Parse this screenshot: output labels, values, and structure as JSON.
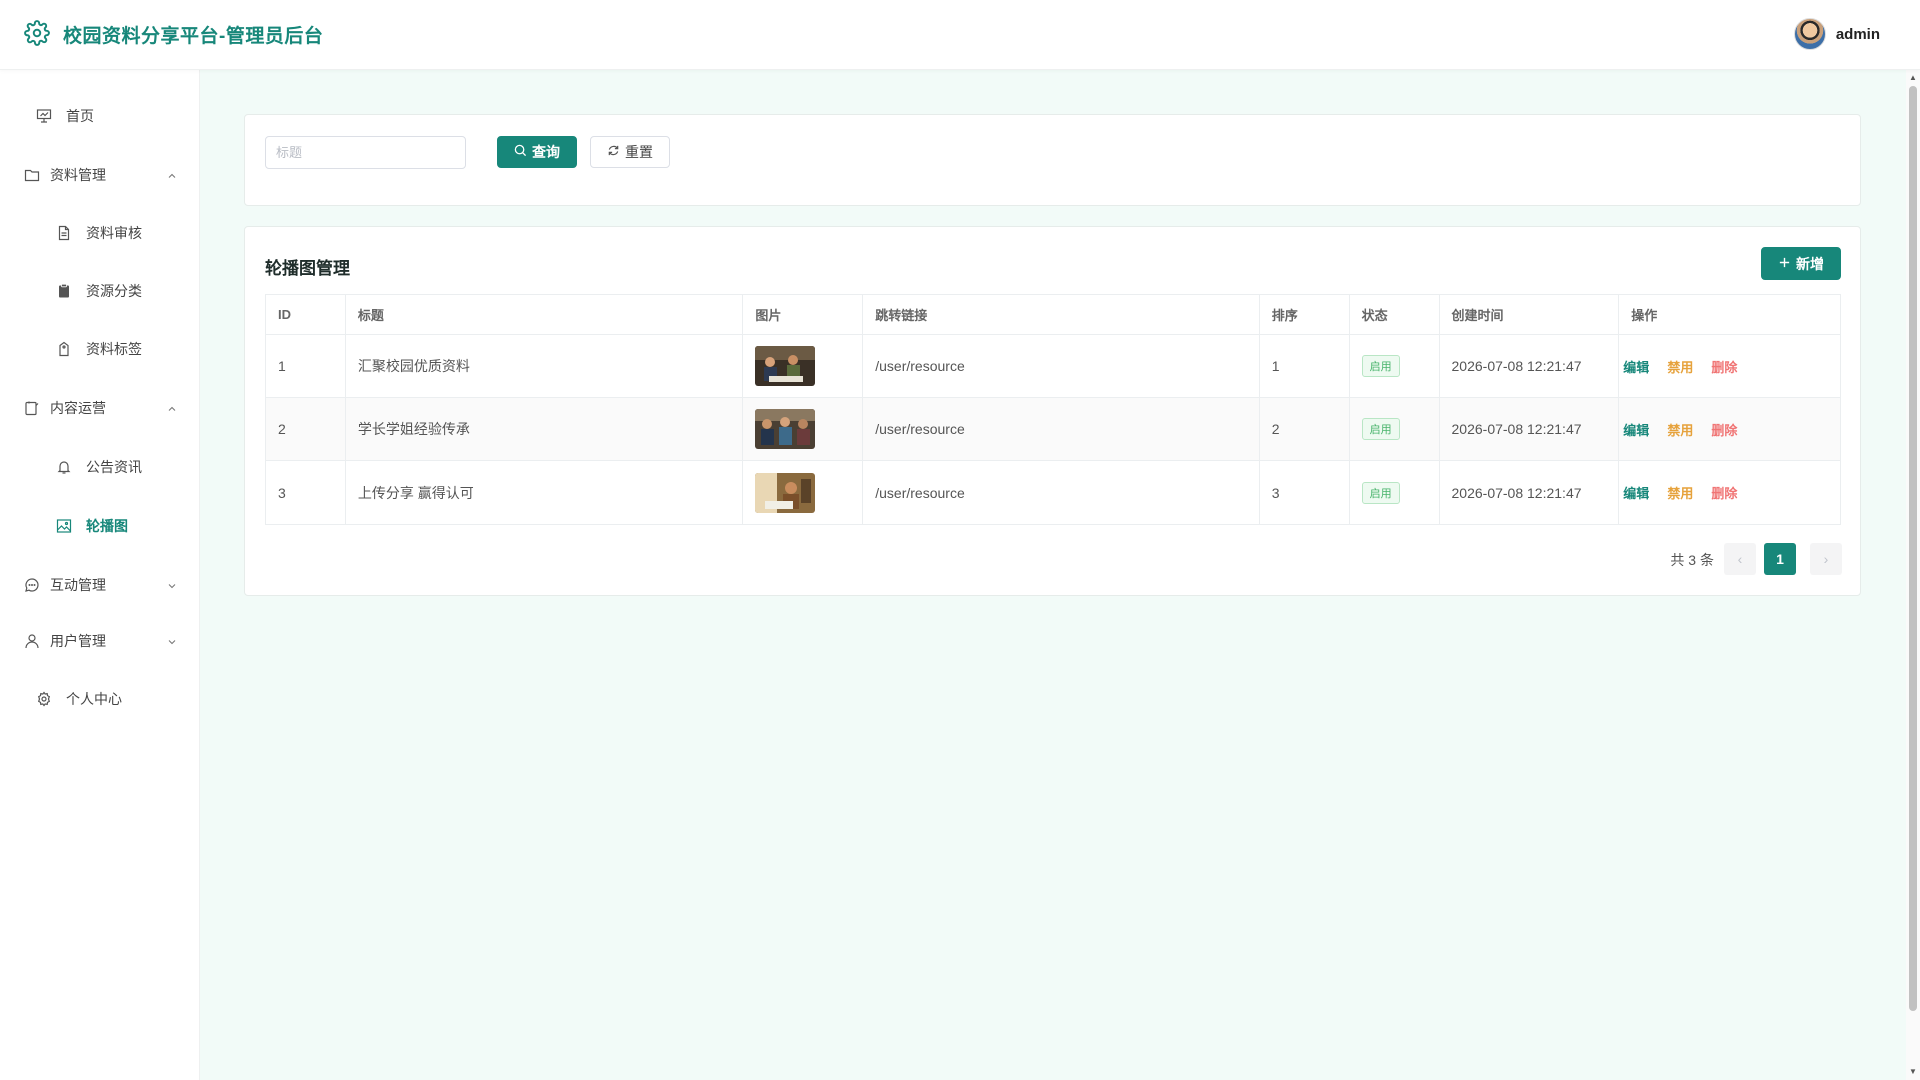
{
  "header": {
    "title": "校园资料分享平台-管理员后台",
    "user_name": "admin"
  },
  "sidebar": {
    "items": [
      {
        "label": "首页",
        "icon": "presentation-icon"
      },
      {
        "label": "资料管理",
        "icon": "folder-icon",
        "expanded": true
      },
      {
        "label": "资料审核",
        "icon": "document-icon"
      },
      {
        "label": "资源分类",
        "icon": "clipboard-icon"
      },
      {
        "label": "资料标签",
        "icon": "tag-icon"
      },
      {
        "label": "内容运营",
        "icon": "notebook-icon",
        "expanded": true
      },
      {
        "label": "公告资讯",
        "icon": "bell-icon"
      },
      {
        "label": "轮播图",
        "icon": "picture-icon",
        "active": true
      },
      {
        "label": "互动管理",
        "icon": "chat-icon",
        "expanded": false
      },
      {
        "label": "用户管理",
        "icon": "user-icon",
        "expanded": false
      },
      {
        "label": "个人中心",
        "icon": "gear-icon"
      }
    ]
  },
  "search": {
    "placeholder": "标题",
    "query_label": "查询",
    "reset_label": "重置"
  },
  "table": {
    "title": "轮播图管理",
    "add_label": "新增",
    "columns": [
      "ID",
      "标题",
      "图片",
      "跳转链接",
      "排序",
      "状态",
      "创建时间",
      "操作"
    ],
    "rows": [
      {
        "id": "1",
        "title": "汇聚校园优质资料",
        "link": "/user/resource",
        "sort": "1",
        "status": "启用",
        "created": "2026-07-08 12:21:47"
      },
      {
        "id": "2",
        "title": "学长学姐经验传承",
        "link": "/user/resource",
        "sort": "2",
        "status": "启用",
        "created": "2026-07-08 12:21:47"
      },
      {
        "id": "3",
        "title": "上传分享 赢得认可",
        "link": "/user/resource",
        "sort": "3",
        "status": "启用",
        "created": "2026-07-08 12:21:47"
      }
    ],
    "actions": {
      "edit": "编辑",
      "disable": "禁用",
      "delete": "删除"
    }
  },
  "pagination": {
    "total_text": "共 3 条",
    "current_page": "1",
    "prev": "‹",
    "next": "›"
  },
  "colors": {
    "primary": "#17877a",
    "background": "#f2fbf8",
    "status_green": "#47b36a",
    "warning": "#e6a23c",
    "danger": "#f07474"
  }
}
